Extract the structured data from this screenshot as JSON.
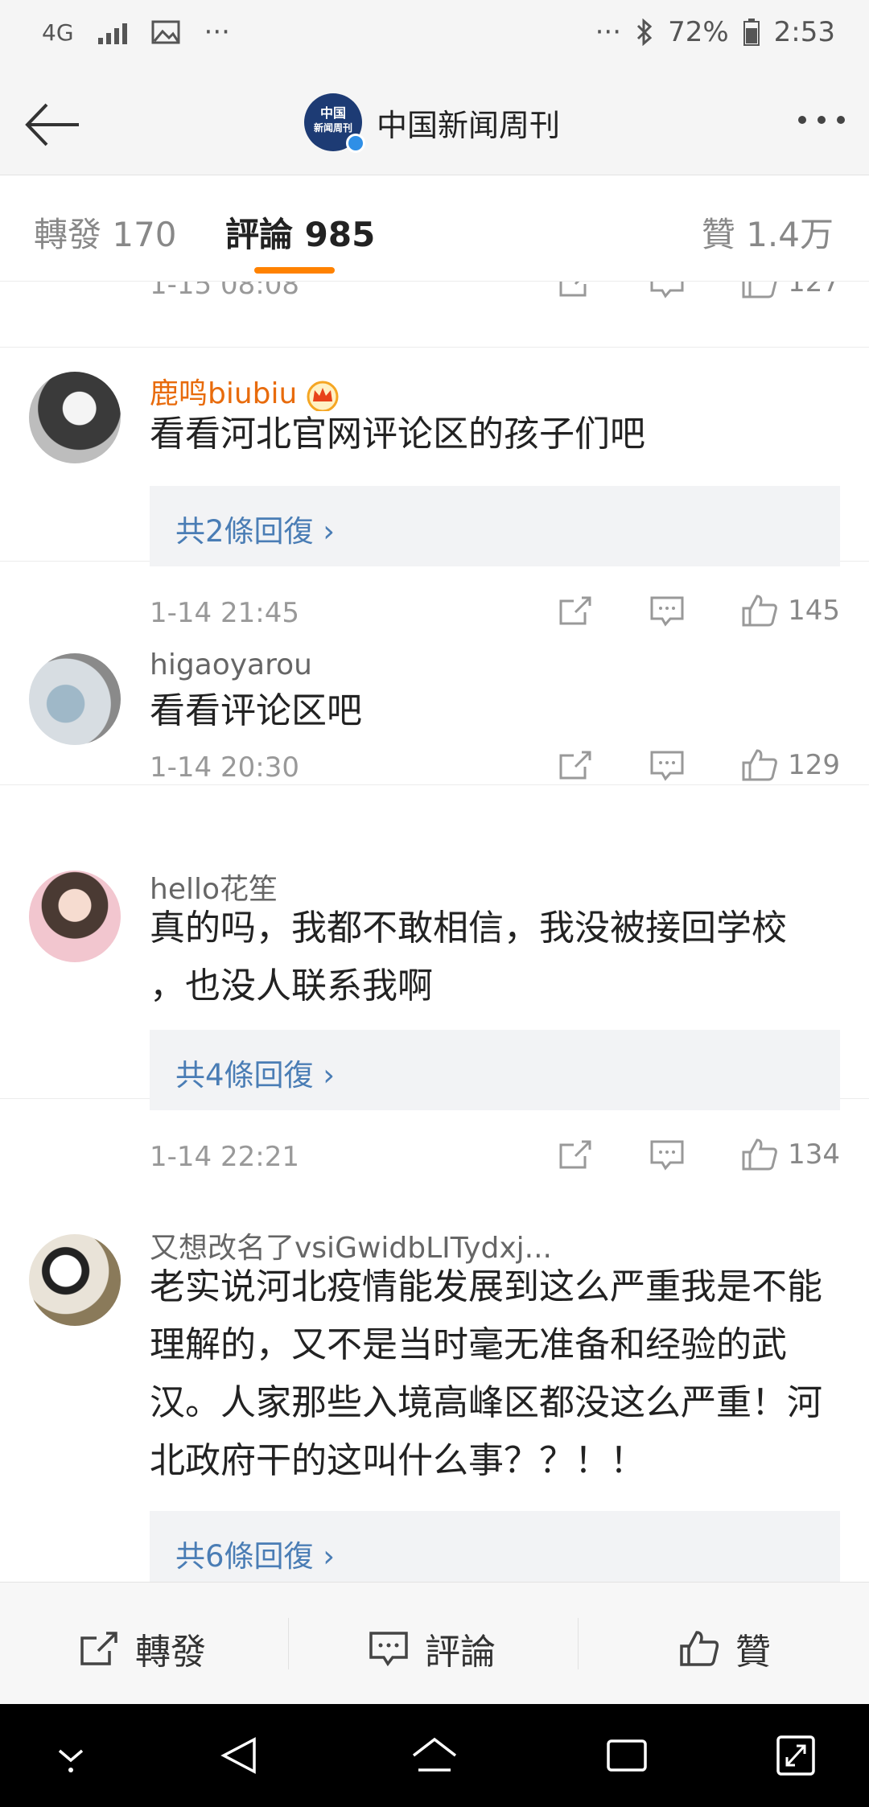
{
  "status_bar": {
    "network": "4G",
    "battery": "72%",
    "time": "2:53",
    "dots": "···"
  },
  "header": {
    "account_name": "中国新闻周刊",
    "logo_text_top": "中国",
    "logo_text_bottom": "新闻周刊"
  },
  "tabs": [
    {
      "label": "轉發 170"
    },
    {
      "label": "評論 985"
    },
    {
      "label": "贊 1.4万"
    }
  ],
  "accent_color": "#ff8200",
  "partial_comment": {
    "time": "1-15 08:08",
    "likes": "127"
  },
  "comments": [
    {
      "user": "鹿鸣biubiu",
      "text": "看看河北官网评论区的孩子们吧",
      "replies": "共2條回復 ›",
      "time": "1-14 21:45",
      "likes": "145"
    },
    {
      "user": "higaoyarou",
      "text": "看看评论区吧",
      "time": "1-14 20:30",
      "likes": "129"
    },
    {
      "user": "hello花笙",
      "text": "真的吗，我都不敢相信，我没被接回学校 ，也没人联系我啊",
      "replies": "共4條回復 ›",
      "time": "1-14 22:21",
      "likes": "134"
    },
    {
      "user": "又想改名了vsiGwidbLITydxj...",
      "text": "老实说河北疫情能发展到这么严重我是不能理解的，又不是当时毫无准备和经验的武汉。人家那些入境高峰区都没这么严重！河北政府干的这叫什么事？？！！",
      "replies": "共6條回復 ›"
    }
  ],
  "action_bar": {
    "repost": "轉發",
    "comment": "評論",
    "like": "贊"
  }
}
